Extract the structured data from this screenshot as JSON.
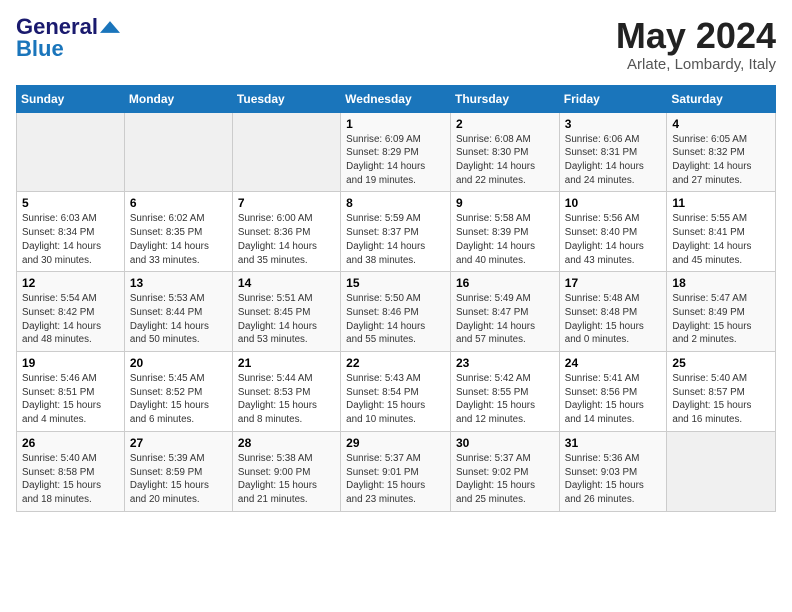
{
  "logo": {
    "general": "General",
    "blue": "Blue",
    "tagline": ""
  },
  "title": "May 2024",
  "location": "Arlate, Lombardy, Italy",
  "days_of_week": [
    "Sunday",
    "Monday",
    "Tuesday",
    "Wednesday",
    "Thursday",
    "Friday",
    "Saturday"
  ],
  "weeks": [
    [
      {
        "day": "",
        "info": ""
      },
      {
        "day": "",
        "info": ""
      },
      {
        "day": "",
        "info": ""
      },
      {
        "day": "1",
        "info": "Sunrise: 6:09 AM\nSunset: 8:29 PM\nDaylight: 14 hours\nand 19 minutes."
      },
      {
        "day": "2",
        "info": "Sunrise: 6:08 AM\nSunset: 8:30 PM\nDaylight: 14 hours\nand 22 minutes."
      },
      {
        "day": "3",
        "info": "Sunrise: 6:06 AM\nSunset: 8:31 PM\nDaylight: 14 hours\nand 24 minutes."
      },
      {
        "day": "4",
        "info": "Sunrise: 6:05 AM\nSunset: 8:32 PM\nDaylight: 14 hours\nand 27 minutes."
      }
    ],
    [
      {
        "day": "5",
        "info": "Sunrise: 6:03 AM\nSunset: 8:34 PM\nDaylight: 14 hours\nand 30 minutes."
      },
      {
        "day": "6",
        "info": "Sunrise: 6:02 AM\nSunset: 8:35 PM\nDaylight: 14 hours\nand 33 minutes."
      },
      {
        "day": "7",
        "info": "Sunrise: 6:00 AM\nSunset: 8:36 PM\nDaylight: 14 hours\nand 35 minutes."
      },
      {
        "day": "8",
        "info": "Sunrise: 5:59 AM\nSunset: 8:37 PM\nDaylight: 14 hours\nand 38 minutes."
      },
      {
        "day": "9",
        "info": "Sunrise: 5:58 AM\nSunset: 8:39 PM\nDaylight: 14 hours\nand 40 minutes."
      },
      {
        "day": "10",
        "info": "Sunrise: 5:56 AM\nSunset: 8:40 PM\nDaylight: 14 hours\nand 43 minutes."
      },
      {
        "day": "11",
        "info": "Sunrise: 5:55 AM\nSunset: 8:41 PM\nDaylight: 14 hours\nand 45 minutes."
      }
    ],
    [
      {
        "day": "12",
        "info": "Sunrise: 5:54 AM\nSunset: 8:42 PM\nDaylight: 14 hours\nand 48 minutes."
      },
      {
        "day": "13",
        "info": "Sunrise: 5:53 AM\nSunset: 8:44 PM\nDaylight: 14 hours\nand 50 minutes."
      },
      {
        "day": "14",
        "info": "Sunrise: 5:51 AM\nSunset: 8:45 PM\nDaylight: 14 hours\nand 53 minutes."
      },
      {
        "day": "15",
        "info": "Sunrise: 5:50 AM\nSunset: 8:46 PM\nDaylight: 14 hours\nand 55 minutes."
      },
      {
        "day": "16",
        "info": "Sunrise: 5:49 AM\nSunset: 8:47 PM\nDaylight: 14 hours\nand 57 minutes."
      },
      {
        "day": "17",
        "info": "Sunrise: 5:48 AM\nSunset: 8:48 PM\nDaylight: 15 hours\nand 0 minutes."
      },
      {
        "day": "18",
        "info": "Sunrise: 5:47 AM\nSunset: 8:49 PM\nDaylight: 15 hours\nand 2 minutes."
      }
    ],
    [
      {
        "day": "19",
        "info": "Sunrise: 5:46 AM\nSunset: 8:51 PM\nDaylight: 15 hours\nand 4 minutes."
      },
      {
        "day": "20",
        "info": "Sunrise: 5:45 AM\nSunset: 8:52 PM\nDaylight: 15 hours\nand 6 minutes."
      },
      {
        "day": "21",
        "info": "Sunrise: 5:44 AM\nSunset: 8:53 PM\nDaylight: 15 hours\nand 8 minutes."
      },
      {
        "day": "22",
        "info": "Sunrise: 5:43 AM\nSunset: 8:54 PM\nDaylight: 15 hours\nand 10 minutes."
      },
      {
        "day": "23",
        "info": "Sunrise: 5:42 AM\nSunset: 8:55 PM\nDaylight: 15 hours\nand 12 minutes."
      },
      {
        "day": "24",
        "info": "Sunrise: 5:41 AM\nSunset: 8:56 PM\nDaylight: 15 hours\nand 14 minutes."
      },
      {
        "day": "25",
        "info": "Sunrise: 5:40 AM\nSunset: 8:57 PM\nDaylight: 15 hours\nand 16 minutes."
      }
    ],
    [
      {
        "day": "26",
        "info": "Sunrise: 5:40 AM\nSunset: 8:58 PM\nDaylight: 15 hours\nand 18 minutes."
      },
      {
        "day": "27",
        "info": "Sunrise: 5:39 AM\nSunset: 8:59 PM\nDaylight: 15 hours\nand 20 minutes."
      },
      {
        "day": "28",
        "info": "Sunrise: 5:38 AM\nSunset: 9:00 PM\nDaylight: 15 hours\nand 21 minutes."
      },
      {
        "day": "29",
        "info": "Sunrise: 5:37 AM\nSunset: 9:01 PM\nDaylight: 15 hours\nand 23 minutes."
      },
      {
        "day": "30",
        "info": "Sunrise: 5:37 AM\nSunset: 9:02 PM\nDaylight: 15 hours\nand 25 minutes."
      },
      {
        "day": "31",
        "info": "Sunrise: 5:36 AM\nSunset: 9:03 PM\nDaylight: 15 hours\nand 26 minutes."
      },
      {
        "day": "",
        "info": ""
      }
    ]
  ]
}
